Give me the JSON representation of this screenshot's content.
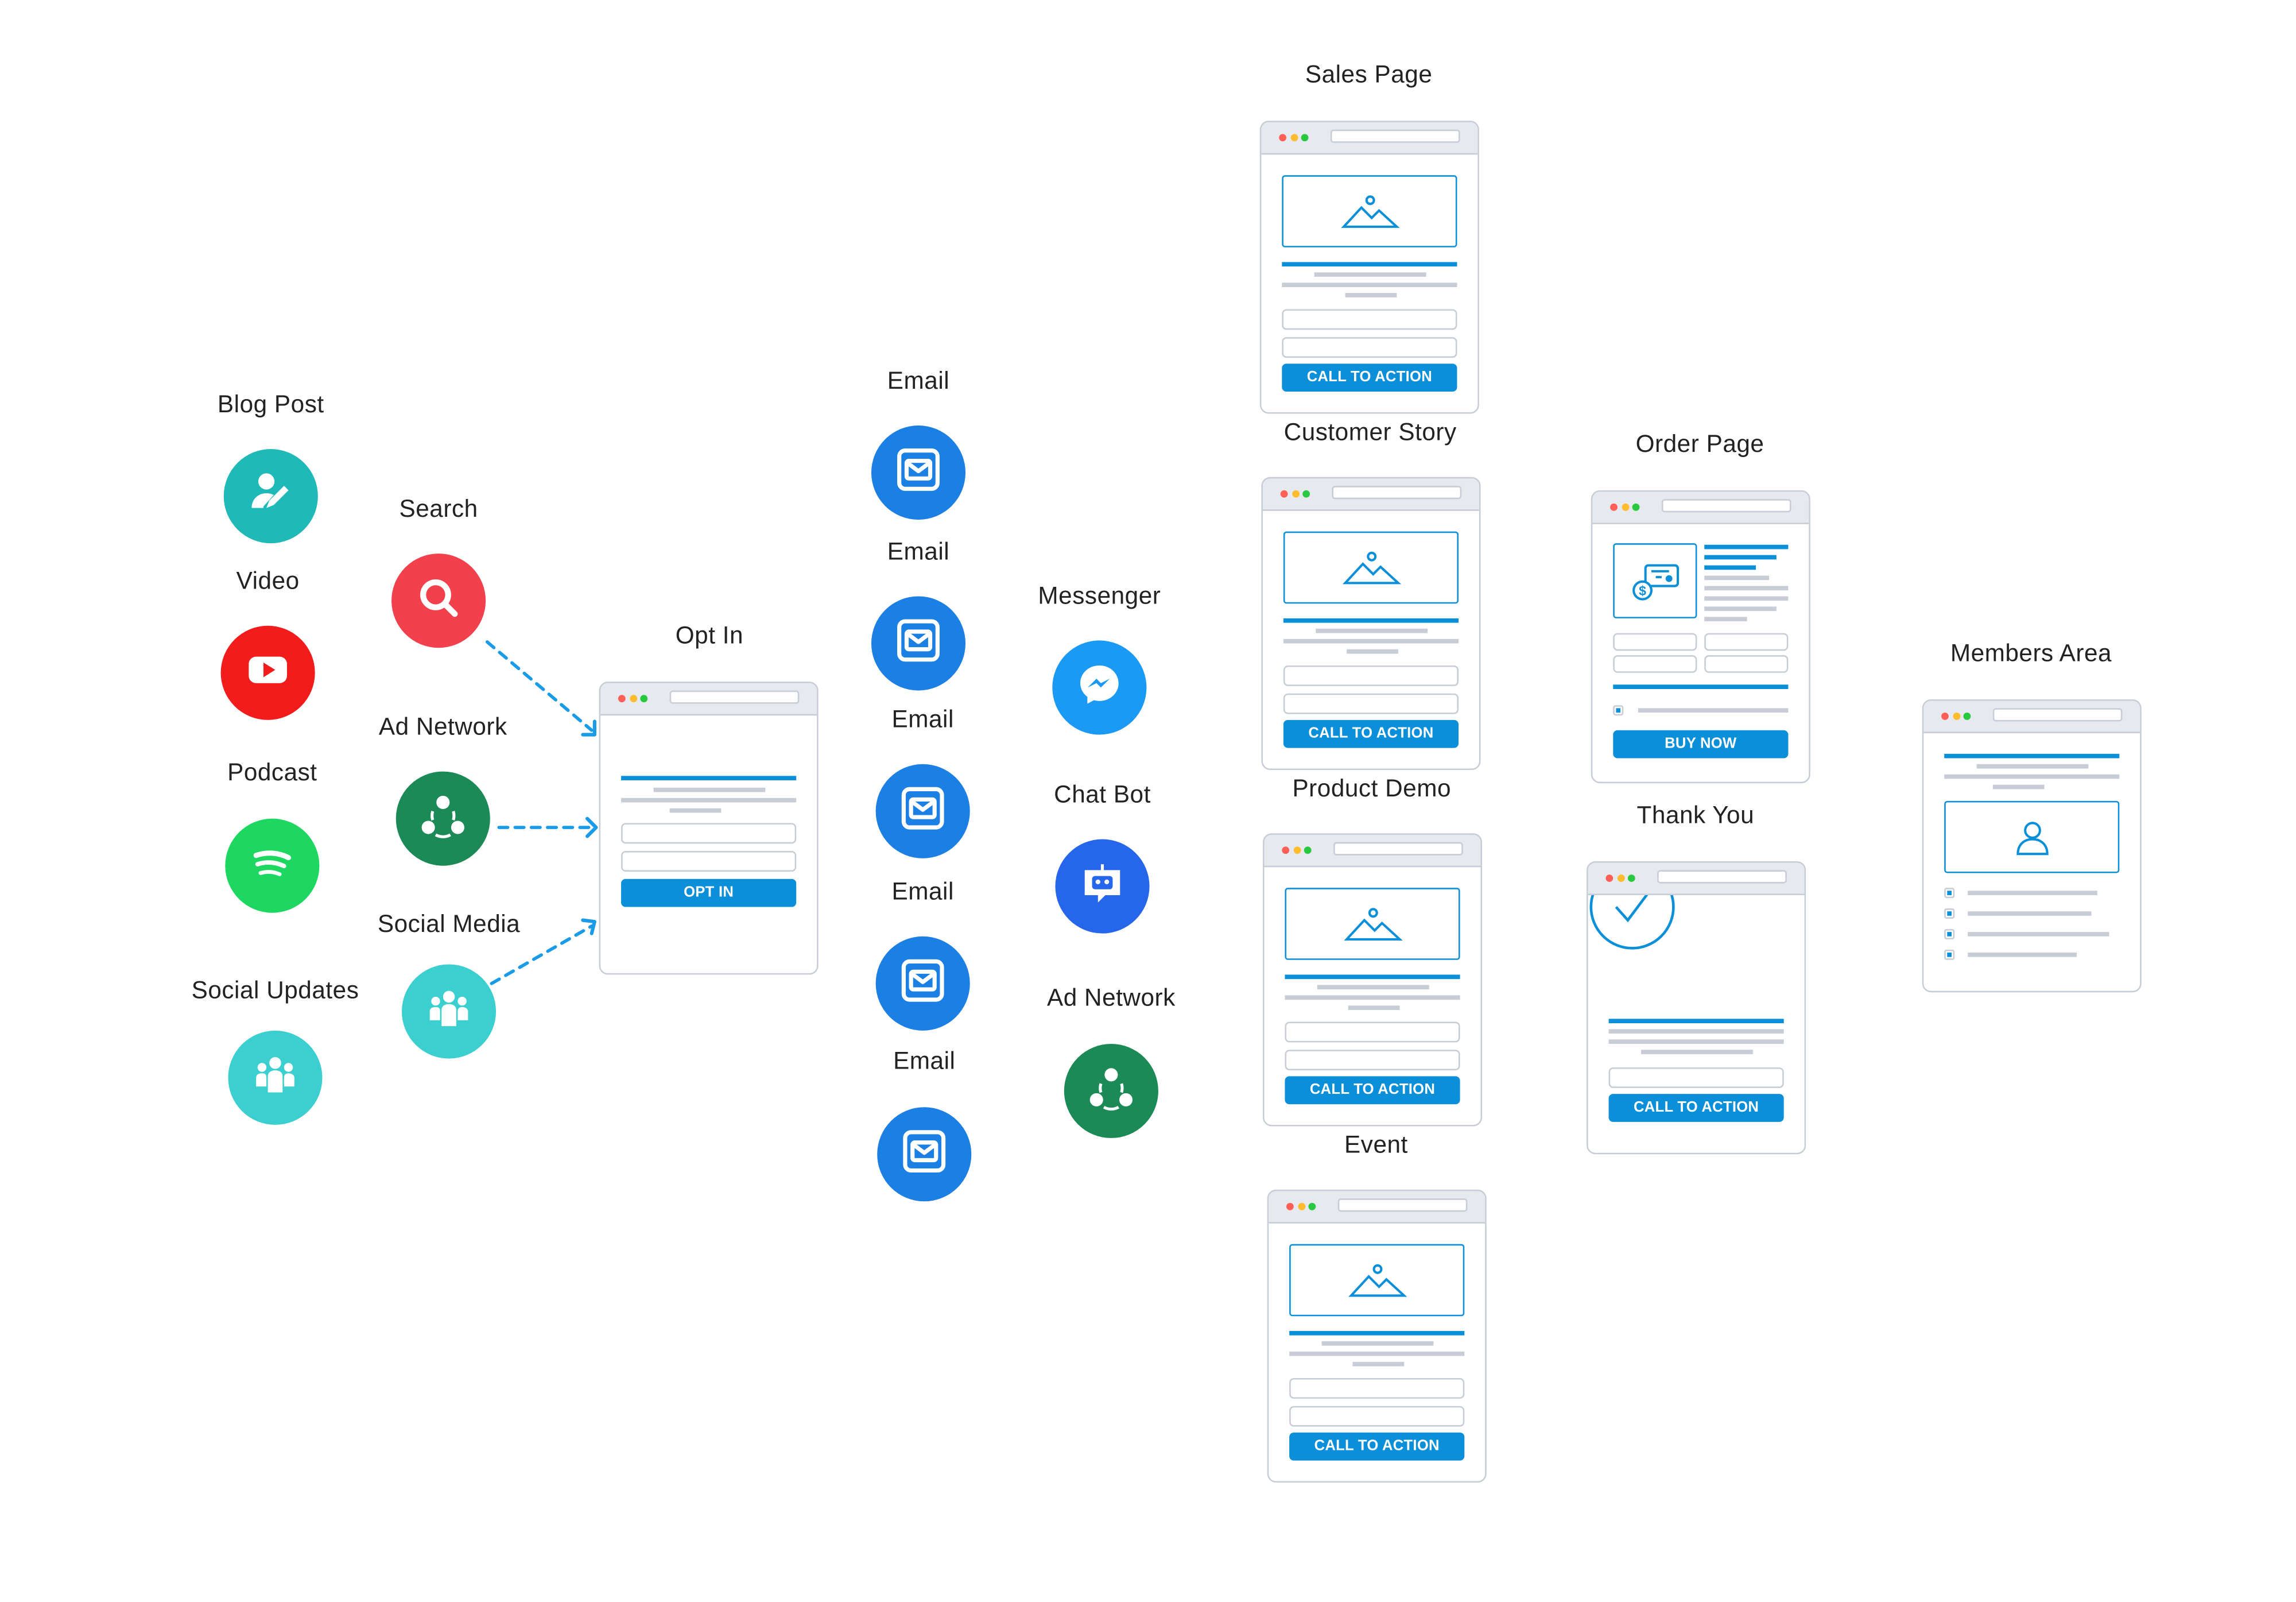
{
  "colors": {
    "accent": "#0a8fd8",
    "arrow": "#1a9be8",
    "window_border": "#c8ccd6"
  },
  "traffic_sources": [
    {
      "key": "blog",
      "label": "Blog Post",
      "icon": "user-edit-icon",
      "color": "#1fb9b7"
    },
    {
      "key": "video",
      "label": "Video",
      "icon": "youtube-icon",
      "color": "#f21c1c"
    },
    {
      "key": "podcast",
      "label": "Podcast",
      "icon": "spotify-icon",
      "color": "#1ed760"
    },
    {
      "key": "social_updates",
      "label": "Social Updates",
      "icon": "people-icon",
      "color": "#3ccfcf"
    },
    {
      "key": "search",
      "label": "Search",
      "icon": "search-icon",
      "color": "#f2404c"
    },
    {
      "key": "ad_network",
      "label": "Ad Network",
      "icon": "ad-network-icon",
      "color": "#1b8a57"
    },
    {
      "key": "social_media",
      "label": "Social Media",
      "icon": "people-icon",
      "color": "#3ccfcf"
    }
  ],
  "followups": [
    {
      "label": "Email",
      "icon": "email-icon",
      "color": "#1b7fe3"
    },
    {
      "label": "Email",
      "icon": "email-icon",
      "color": "#1b7fe3"
    },
    {
      "label": "Email",
      "icon": "email-icon",
      "color": "#1b7fe3"
    },
    {
      "label": "Email",
      "icon": "email-icon",
      "color": "#1b7fe3"
    },
    {
      "label": "Email",
      "icon": "email-icon",
      "color": "#1b7fe3"
    },
    {
      "label": "Messenger",
      "icon": "messenger-icon",
      "color": "#1a9af5"
    },
    {
      "label": "Chat Bot",
      "icon": "chatbot-icon",
      "color": "#2566eb"
    },
    {
      "label": "Ad Network",
      "icon": "ad-network-icon",
      "color": "#1b8a57"
    }
  ],
  "pages": [
    {
      "title": "Opt In",
      "type": "optin",
      "button": "OPT IN"
    },
    {
      "title": "Sales Page",
      "type": "sales",
      "button": "CALL TO ACTION"
    },
    {
      "title": "Customer Story",
      "type": "sales",
      "button": "CALL TO ACTION"
    },
    {
      "title": "Product Demo",
      "type": "sales",
      "button": "CALL TO ACTION"
    },
    {
      "title": "Event",
      "type": "sales",
      "button": "CALL TO ACTION"
    },
    {
      "title": "Order Page",
      "type": "order",
      "button": "BUY NOW"
    },
    {
      "title": "Thank You",
      "type": "thanks",
      "button": "CALL TO ACTION"
    },
    {
      "title": "Members Area",
      "type": "members"
    }
  ]
}
